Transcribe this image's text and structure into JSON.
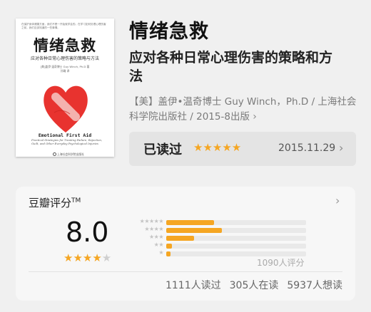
{
  "cover": {
    "quote": "在保护身体健康方面，我们不是一开始就学会的。在学习如何处理心理伤害之前，我们应该知道的一些事情。",
    "title": "情绪急救",
    "subtitle": "应对各种日常心理伤害的策略与方法",
    "author": "[美]盖伊·温奇博士 Guy Winch, Ph.D 著",
    "translator": "孙璐 译",
    "en_title": "Emotional First Aid",
    "en_sub": "Practical Strategies for Treating Failure, Rejection, Guilt, and Other Everyday Psychological Injuries",
    "publisher": "上海社会科学院出版社"
  },
  "book": {
    "title": "情绪急救",
    "subtitle": "应对各种日常心理伤害的策略和方法",
    "meta": "【美】盖伊•温奇博士 Guy Winch，Ph.D / 上海社会科学院出版社 / 2015-8出版",
    "meta_chevron": "›"
  },
  "read_status": {
    "label": "已读过",
    "stars": "★★★★★",
    "user_rating": 5,
    "date": "2015.11.29",
    "chevron": "›"
  },
  "rating": {
    "title": "豆瓣评分",
    "tm": "TM",
    "chevron": "›",
    "score": "8.0",
    "stars_on": "★★★★",
    "stars_off": "★",
    "distribution": [
      {
        "stars": "★★★★★",
        "fraction": 0.34
      },
      {
        "stars": "★★★★",
        "fraction": 0.4
      },
      {
        "stars": "★★★",
        "fraction": 0.2
      },
      {
        "stars": "★★",
        "fraction": 0.04
      },
      {
        "stars": "★",
        "fraction": 0.03
      }
    ],
    "count": "1090人评分",
    "read": "1111人读过",
    "reading": "305人在读",
    "want": "5937人想读"
  },
  "colors": {
    "accent_star": "#f5a623",
    "heart": "#e8332f",
    "background": "#f0f0f0"
  },
  "icons": [
    "chevron-right-icon",
    "star-icon",
    "heart-bandage-icon"
  ]
}
